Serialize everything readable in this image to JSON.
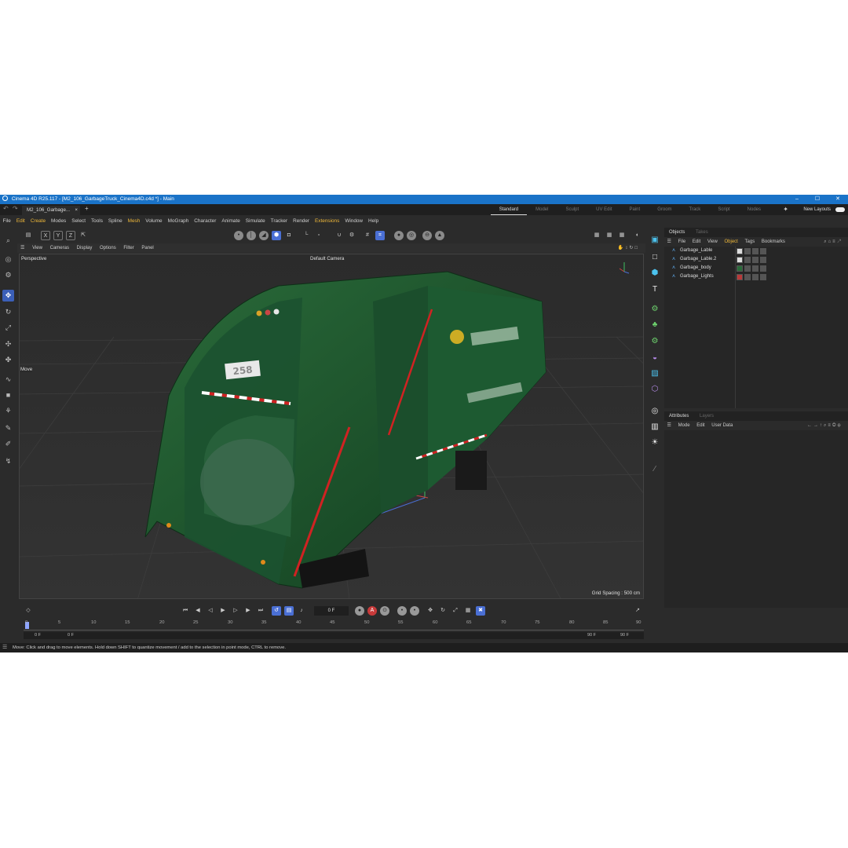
{
  "window": {
    "title": "Cinema 4D R25.117 - [M2_106_GarbageTruck_Cinema4D.c4d *] - Main",
    "controls": [
      "–",
      "☐",
      "✕"
    ]
  },
  "tabs": {
    "doc_tab": "M2_106_Garbage...",
    "close": "×",
    "add": "+"
  },
  "layouts": [
    "Standard",
    "Model",
    "Sculpt",
    "UV Edit",
    "Paint",
    "Groom",
    "Track",
    "Script",
    "Nodes"
  ],
  "active_layout": "Standard",
  "new_layouts": "New Layouts",
  "menu": [
    "File",
    "Edit",
    "Create",
    "Modes",
    "Select",
    "Tools",
    "Spline",
    "Mesh",
    "Volume",
    "MoGraph",
    "Character",
    "Animate",
    "Simulate",
    "Tracker",
    "Render",
    "Extensions",
    "Window",
    "Help"
  ],
  "toolbar": {
    "axis_x": "X",
    "axis_y": "Y",
    "axis_z": "Z"
  },
  "viewport_menu": [
    "View",
    "Cameras",
    "Display",
    "Options",
    "Filter",
    "Panel"
  ],
  "viewport": {
    "projection": "Perspective",
    "camera": "Default Camera",
    "tool_label": "Move",
    "grid_spacing": "Grid Spacing : 500 cm",
    "truck_number": "258"
  },
  "objects_panel": {
    "tabs": [
      "Objects",
      "Takes"
    ],
    "menu": [
      "File",
      "Edit",
      "View",
      "Object",
      "Tags",
      "Bookmarks"
    ],
    "items": [
      {
        "name": "Garbage_Lable"
      },
      {
        "name": "Garbage_Lable.2"
      },
      {
        "name": "Garbage_body"
      },
      {
        "name": "Garbage_Lights"
      }
    ]
  },
  "attributes_panel": {
    "tabs": [
      "Attributes",
      "Layers"
    ],
    "menu": [
      "Mode",
      "Edit",
      "User Data"
    ]
  },
  "timeline": {
    "current_frame": "0 F",
    "ticks": [
      "0",
      "5",
      "10",
      "15",
      "20",
      "25",
      "30",
      "35",
      "40",
      "45",
      "50",
      "55",
      "60",
      "65",
      "70",
      "75",
      "80",
      "85",
      "90"
    ],
    "range_start": "0 F",
    "range_start2": "0 F",
    "range_end": "90 F",
    "range_end2": "90 F"
  },
  "status": "Move: Click and drag to move elements. Hold down SHIFT to quantize movement / add to the selection in point mode, CTRL to remove.",
  "colors": {
    "titlebar": "#1a73c8",
    "accent": "#4a6fd4",
    "highlight": "#f0b93a",
    "truck": "#1f5a2f"
  }
}
